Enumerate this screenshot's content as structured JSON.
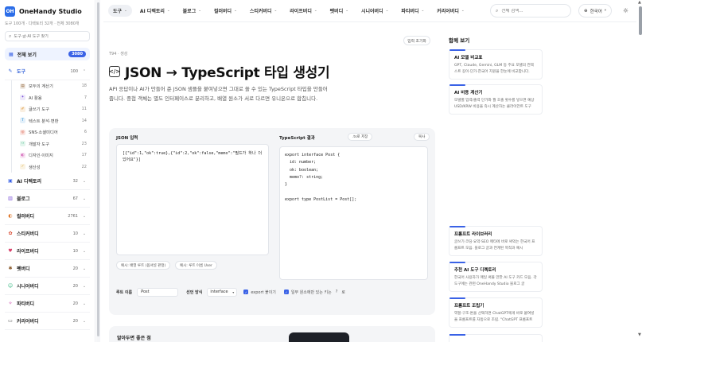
{
  "brand": {
    "logo_mark": "OH",
    "name": "OneHandy Studio",
    "stats": "도구 100개 · 디렉토리 32개 · 전체 3080개"
  },
  "sidebar": {
    "search_placeholder": "도구·글·AI 도구 찾기",
    "all_view": {
      "label": "전체 보기",
      "count": "3080"
    },
    "categories": [
      {
        "name": "도구",
        "count": "100",
        "icon": "wrench-icon",
        "color": "#2b5bd7",
        "open": true,
        "subs": [
          {
            "name": "모두의 계산기",
            "count": "18",
            "icon": "calculator-icon",
            "color": "#8a5a2b"
          },
          {
            "name": "AI 활용",
            "count": "7",
            "icon": "sparkle-icon",
            "color": "#7a4fd8"
          },
          {
            "name": "글쓰기 도구",
            "count": "11",
            "icon": "pencil-icon",
            "color": "#d88a1f"
          },
          {
            "name": "텍스트 분석·변환",
            "count": "14",
            "icon": "text-icon",
            "color": "#2b8fd8"
          },
          {
            "name": "SNS·소셜미디어",
            "count": "6",
            "icon": "share-icon",
            "color": "#d8452b"
          },
          {
            "name": "개발자 도구",
            "count": "23",
            "icon": "code-icon",
            "color": "#2bb37a"
          },
          {
            "name": "디자인·이미지",
            "count": "17",
            "icon": "palette-icon",
            "color": "#c83fa8"
          },
          {
            "name": "생산성",
            "count": "22",
            "icon": "check-icon",
            "color": "#d8a42b"
          }
        ]
      },
      {
        "name": "AI 디렉토리",
        "count": "32",
        "icon": "robot-icon",
        "color": "#3a62e6"
      },
      {
        "name": "블로그",
        "count": "67",
        "icon": "blog-icon",
        "color": "#7a4fd8"
      },
      {
        "name": "컬러버디",
        "count": "2761",
        "icon": "palette-icon",
        "color": "#e0782b"
      },
      {
        "name": "스티커버디",
        "count": "10",
        "icon": "sticker-icon",
        "color": "#d8452b"
      },
      {
        "name": "라이프버디",
        "count": "10",
        "icon": "heart-icon",
        "color": "#d83f6a"
      },
      {
        "name": "펫버디",
        "count": "20",
        "icon": "paw-icon",
        "color": "#8a5a2b"
      },
      {
        "name": "시니어버디",
        "count": "20",
        "icon": "senior-icon",
        "color": "#2bb37a"
      },
      {
        "name": "파티버디",
        "count": "20",
        "icon": "party-icon",
        "color": "#c83fa8"
      },
      {
        "name": "커리어버디",
        "count": "20",
        "icon": "briefcase-icon",
        "color": "#555555"
      }
    ]
  },
  "topnav": {
    "items": [
      {
        "label": "도구",
        "active": true
      },
      {
        "label": "AI 디렉토리"
      },
      {
        "label": "블로그"
      },
      {
        "label": "컬러버디"
      },
      {
        "label": "스티커버디"
      },
      {
        "label": "라이프버디"
      },
      {
        "label": "펫버디"
      },
      {
        "label": "시니어버디"
      },
      {
        "label": "파티버디"
      },
      {
        "label": "커리어버디"
      }
    ],
    "search_placeholder": "전체 검색...",
    "language": "한국어"
  },
  "main": {
    "reset_label": "입력 초기화",
    "breadcrumb": "T94 · 생성",
    "title": "JSON → TypeScript 타입 생성기",
    "description": "API 응답이나 AI가 만들어 준 JSON 샘플을 붙여넣으면 그대로 쓸 수 있는 TypeScript 타입을 만들어 줍니다. 중첩 객체는 별도 인터페이스로 분리하고, 배열 원소가 서로 다르면 유니온으로 합칩니다.",
    "input_label": "JSON 입력",
    "input_value": "[{\"id\":1,\"ok\":true},{\"id\":2,\"ok\":false,\"memo\":\"필드가 하나 더 있어요\"}]",
    "example1": "예시: 배열 루트 (옵셔널 판정)",
    "example2": "예시: 루트 이름 User",
    "output_label": "TypeScript 결과",
    "save_label": ".ts로 저장",
    "copy_label": "복사",
    "output_code": "export interface Post {\n  id: number;\n  ok: boolean;\n  memo?: string;\n}\n\nexport type PostList = Post[];",
    "root_label": "루트 이름",
    "root_value": "Post",
    "decl_label": "선언 방식",
    "decl_value": "interface",
    "export_label": "export 붙이기",
    "optional_label": "일부 원소에만 있는 키는",
    "optional_help": "?",
    "optional_suffix": "로",
    "bottom_title": "알아두면 좋은 점"
  },
  "right": {
    "title": "함께 보기",
    "cards_top": [
      {
        "title": "AI 모델 비교표",
        "desc": "GPT, Claude, Gemini, GLM 등 주요 모델의 컨텍스트 길이·단가·한국어 지원을 한눈에 비교합니다."
      },
      {
        "title": "AI 비용 계산기",
        "desc": "모델별 입력/출력 단가와 월 호출 횟수를 넣으면 예상 USD/KRW 비용을 즉시 계산하는 클라이언트 도구"
      }
    ],
    "cards_bottom": [
      {
        "title": "프롬프트 라이브러리",
        "desc": "글쓰기·코딩·요약·SEO 메타에 바로 써먹는 한국어 프롬프트 모음. 블로그 글과 연계된 목적과 예시"
      },
      {
        "title": "추천 AI 도구 디렉토리",
        "desc": "한국어 사용자가 매일 써볼 만한 AI 도구 카드 모음. 각 도구에는 관련 OneHandy Studio 블로그 글"
      },
      {
        "title": "프롬프트 조립기",
        "desc": "역할·구조·톤을 선택하면 ChatGPT에게 바로 붙여넣을 프롬프트를 자동으로 조립. \"ChatGPT 프롬프트"
      }
    ]
  }
}
